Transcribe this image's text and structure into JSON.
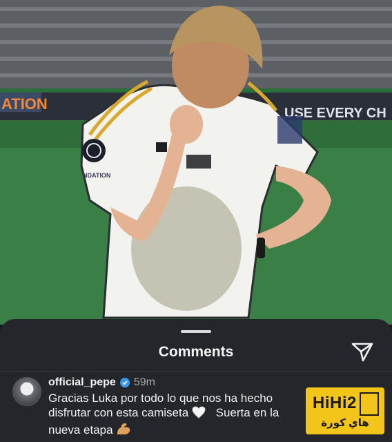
{
  "photo": {
    "banner_left": "ATION",
    "banner_right": "USE EVERY CH",
    "badge_text": "NDATION"
  },
  "sheet": {
    "title": "Comments"
  },
  "comment": {
    "username": "official_pepe",
    "time": "59m",
    "lines": [
      "Gracias Luka por todo lo que nos ha hecho",
      "disfrutar con esta camiseta",
      "Suerta en la",
      "nueva etapa"
    ],
    "emoji_heart": "white-heart-icon",
    "emoji_arm": "flexed-biceps-icon"
  },
  "watermark": {
    "logo_text": "HiHi2",
    "arabic_text": "هاي كورة"
  },
  "colors": {
    "sheet_bg": "#24262b",
    "verified_blue": "#3897f0",
    "watermark_yellow": "#f3c51b"
  }
}
